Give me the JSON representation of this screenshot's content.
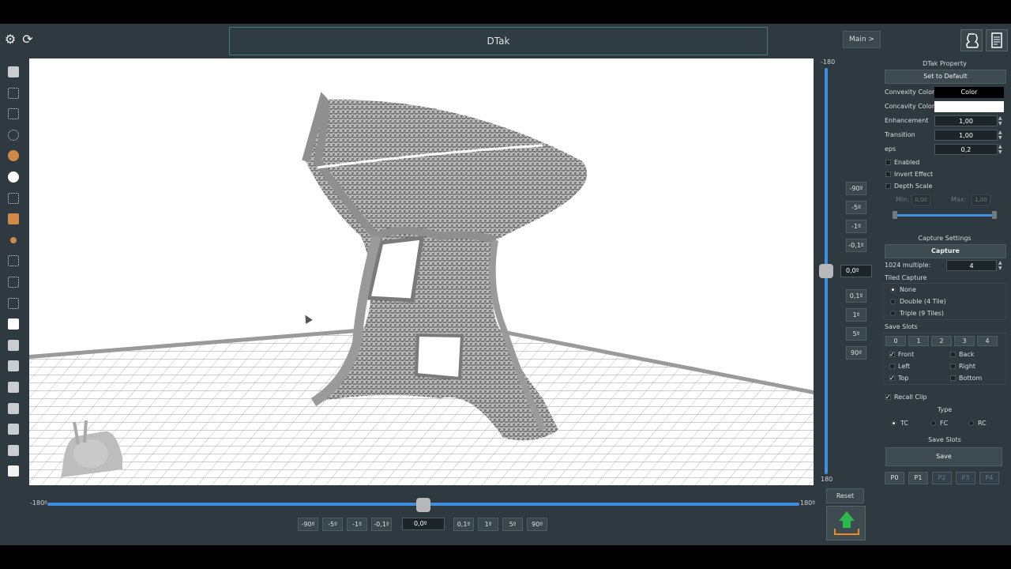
{
  "app": {
    "title": "DTak",
    "main_button": "Main >"
  },
  "toolbar_icons": [
    "gear-icon",
    "refresh-icon"
  ],
  "header_icons": [
    "vase-icon",
    "document-icon"
  ],
  "left_tools": [
    "cylinder-icon",
    "mesh-cylinder-icon",
    "wire-cylinder-icon",
    "point-cloud-icon",
    "color-vase-icon",
    "white-vase-icon",
    "wire-cube-icon",
    "layered-plane-icon",
    "axes-icon",
    "grid-cube-icon",
    "book-icon",
    "columns-icon",
    "center-view-icon",
    "cube-view-1-icon",
    "cube-view-2-icon",
    "cube-view-3-icon",
    "cube-view-4-icon",
    "cube-view-5-icon",
    "cube-view-6-icon",
    "solid-cube-icon"
  ],
  "vertical_slider": {
    "min_label": "-180",
    "max_label": "180",
    "value": "0,0º",
    "steps_up": [
      "-90º",
      "-5º",
      "-1º",
      "-0,1º"
    ],
    "steps_down": [
      "0,1º",
      "1º",
      "5º",
      "90º"
    ]
  },
  "horizontal_slider": {
    "min_label": "-180º",
    "max_label": "180º",
    "value": "0,0º",
    "steps_left": [
      "-90º",
      "-5º",
      "-1º",
      "-0,1º"
    ],
    "steps_right": [
      "0,1º",
      "1º",
      "5º",
      "90º"
    ]
  },
  "reset_label": "Reset",
  "dtak_property": {
    "title": "DTak Property",
    "set_default": "Set to Default",
    "convexity_label": "Convexity Color",
    "convexity_value": "Color",
    "concavity_label": "Concavity Color",
    "enhancement_label": "Enhancement",
    "enhancement_value": "1,00",
    "transition_label": "Transition",
    "transition_value": "1,00",
    "eps_label": "eps",
    "eps_value": "0,2",
    "enabled_label": "Enabled",
    "invert_label": "Invert Effect",
    "depth_label": "Depth Scale",
    "min_label": "Min:",
    "min_value": "0,00",
    "max_label": "Max:",
    "max_value": "1,00"
  },
  "capture": {
    "title": "Capture Settings",
    "capture_button": "Capture",
    "multiple_label": "1024 multiple:",
    "multiple_value": "4",
    "tiled_label": "Tiled Capture",
    "tiled_options": [
      "None",
      "Double (4 Tile)",
      "Triple (9 Tiles)"
    ],
    "tiled_selected": "None",
    "slots_label": "Save Slots",
    "slot_numbers": [
      "0",
      "1",
      "2",
      "3",
      "4"
    ],
    "views": [
      {
        "label": "Front",
        "checked": true
      },
      {
        "label": "Back",
        "checked": false
      },
      {
        "label": "Left",
        "checked": false
      },
      {
        "label": "Right",
        "checked": false
      },
      {
        "label": "Top",
        "checked": true
      },
      {
        "label": "Bottom",
        "checked": false
      }
    ],
    "recall_clip": "Recall Clip",
    "type_label": "Type",
    "types": [
      "TC",
      "FC",
      "RC"
    ],
    "type_selected": "TC",
    "save_slots_label": "Save Slots",
    "save_button": "Save",
    "presets": [
      "P0",
      "P1",
      "P2",
      "P3",
      "P4"
    ]
  },
  "colors": {
    "accent": "#3f8fe0",
    "panel_bg": "#2e3a40",
    "title_border": "#3d7d70",
    "export_green": "#2db94a",
    "export_orange": "#f08a24"
  }
}
